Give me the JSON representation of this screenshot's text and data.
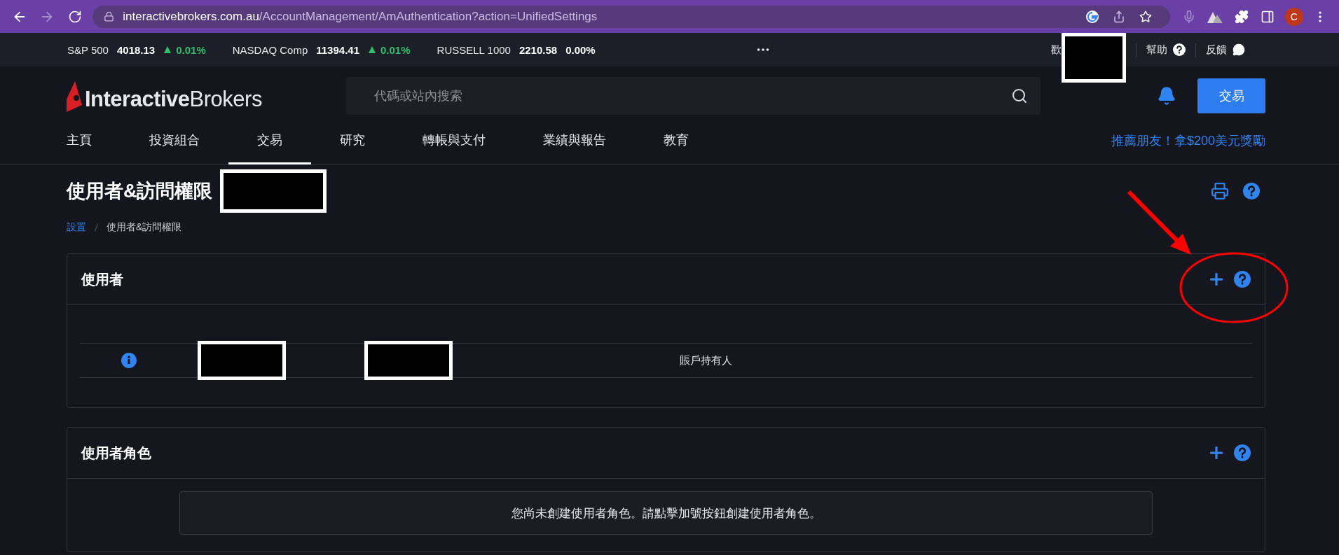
{
  "browser": {
    "url_host": "interactivebrokers.com.au",
    "url_path": "/AccountManagement/AmAuthentication?action=UnifiedSettings",
    "profile_initial": "C"
  },
  "ticker": [
    {
      "name": "S&P 500",
      "value": "4018.13",
      "change": "0.01%",
      "rising": true
    },
    {
      "name": "NASDAQ Comp",
      "value": "11394.41",
      "change": "0.01%",
      "rising": true
    },
    {
      "name": "RUSSELL 1000",
      "value": "2210.58",
      "change": "0.00%",
      "rising": false
    }
  ],
  "top_links": {
    "welcome": "歡",
    "help": "幫助",
    "feedback": "反饋"
  },
  "header": {
    "logo_bold": "Interactive",
    "logo_light": "Brokers",
    "search": {
      "placeholder": "代碼或站內搜索"
    },
    "trade_button": "交易"
  },
  "nav": [
    {
      "label": "主頁",
      "selected": false
    },
    {
      "label": "投資組合",
      "selected": false
    },
    {
      "label": "交易",
      "selected": true
    },
    {
      "label": "研究",
      "selected": false
    },
    {
      "label": "轉帳與支付",
      "selected": false
    },
    {
      "label": "業績與報告",
      "selected": false
    },
    {
      "label": "教育",
      "selected": false
    }
  ],
  "referral": "推薦朋友！拿$200美元獎勵",
  "page": {
    "title": "使用者&訪問權限",
    "breadcrumb": [
      {
        "label": "設置",
        "kind": "link"
      },
      {
        "label": "使用者&訪問權限",
        "kind": "current"
      }
    ]
  },
  "panels": [
    {
      "title": "使用者",
      "rows": [
        {
          "cells": [
            {
              "kind": "info"
            },
            {
              "kind": "redacted"
            },
            {
              "kind": "redacted"
            },
            {
              "kind": "text",
              "text": "賬戶持有人"
            }
          ]
        }
      ]
    },
    {
      "title": "使用者角色",
      "message": "您尚未創建使用者角色。請點擊加號按鈕創建使用者角色。"
    }
  ]
}
